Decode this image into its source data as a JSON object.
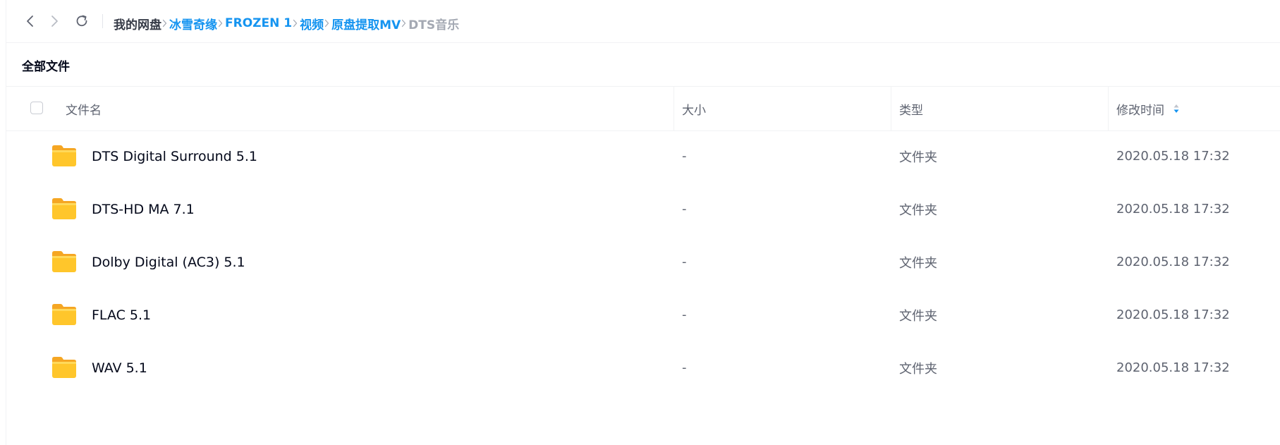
{
  "toolbar": {
    "back_icon": "chevron-left-icon",
    "forward_icon": "chevron-right-icon",
    "refresh_icon": "refresh-icon"
  },
  "breadcrumb": {
    "root": "我的网盘",
    "items": [
      "冰雪奇缘",
      "FROZEN 1",
      "视频",
      "原盘提取MV"
    ],
    "current": "DTS音乐"
  },
  "section": {
    "title": "全部文件"
  },
  "table": {
    "headers": {
      "name": "文件名",
      "size": "大小",
      "type": "类型",
      "modified": "修改时间"
    },
    "sort_icon": "sort-arrows-icon",
    "sort_active_color": "#1594f0",
    "rows": [
      {
        "name": "DTS Digital Surround 5.1",
        "size": "-",
        "type": "文件夹",
        "modified": "2020.05.18 17:32",
        "icon": "folder-icon"
      },
      {
        "name": "DTS-HD MA 7.1",
        "size": "-",
        "type": "文件夹",
        "modified": "2020.05.18 17:32",
        "icon": "folder-icon"
      },
      {
        "name": "Dolby Digital (AC3) 5.1",
        "size": "-",
        "type": "文件夹",
        "modified": "2020.05.18 17:32",
        "icon": "folder-icon"
      },
      {
        "name": "FLAC 5.1",
        "size": "-",
        "type": "文件夹",
        "modified": "2020.05.18 17:32",
        "icon": "folder-icon"
      },
      {
        "name": "WAV 5.1",
        "size": "-",
        "type": "文件夹",
        "modified": "2020.05.18 17:32",
        "icon": "folder-icon"
      }
    ]
  },
  "colors": {
    "link": "#1594f0",
    "folder": "#ffc62b",
    "text_primary": "#03081a",
    "text_secondary": "#5e6370"
  }
}
